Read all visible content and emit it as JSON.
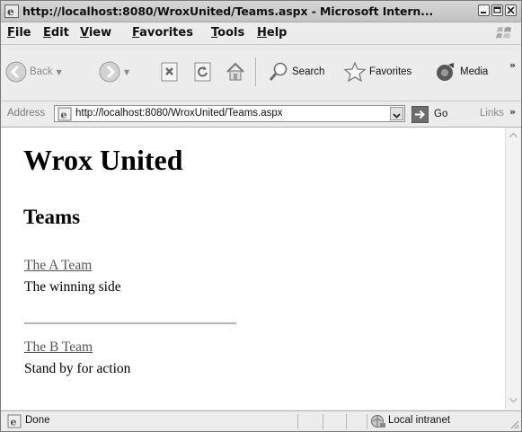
{
  "window": {
    "title": "http://localhost:8080/WroxUnited/Teams.aspx - Microsoft Intern..."
  },
  "menu": {
    "items": [
      "File",
      "Edit",
      "View",
      "Favorites",
      "Tools",
      "Help"
    ]
  },
  "toolbar": {
    "back_label": "Back",
    "search_label": "Search",
    "favorites_label": "Favorites",
    "media_label": "Media",
    "overflow": "»"
  },
  "address": {
    "label": "Address",
    "url": "http://localhost:8080/WroxUnited/Teams.aspx",
    "go_label": "Go",
    "links_label": "Links",
    "links_overflow": "»"
  },
  "page": {
    "heading": "Wrox United",
    "subheading": "Teams",
    "teams": [
      {
        "name": "The A Team",
        "description": "The winning side"
      },
      {
        "name": "The B Team",
        "description": "Stand by for action"
      }
    ]
  },
  "status": {
    "text": "Done",
    "zone": "Local intranet"
  },
  "colors": {
    "chrome": "#ececec",
    "content_bg": "#ffffff",
    "link": "#555555"
  }
}
